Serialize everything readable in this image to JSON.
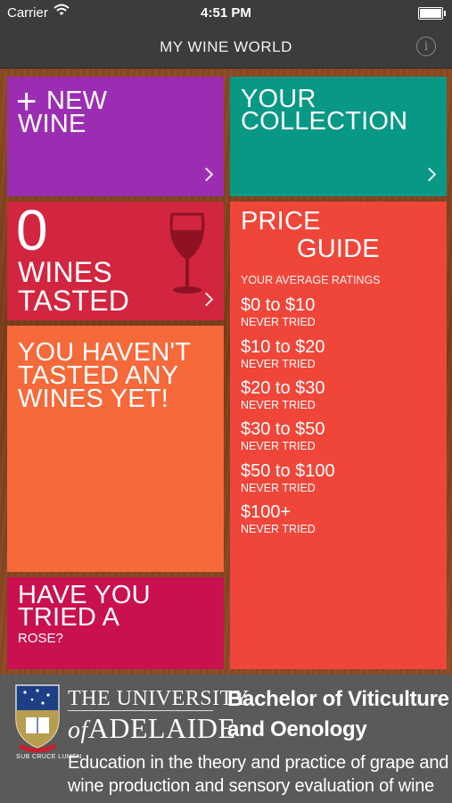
{
  "status_bar": {
    "carrier": "Carrier",
    "time": "4:51 PM"
  },
  "nav": {
    "title": "MY WINE WORLD",
    "info_icon": "i"
  },
  "tiles": {
    "new_wine": {
      "plus": "+",
      "line1": "NEW",
      "line2": "WINE"
    },
    "collection": {
      "line1": "YOUR",
      "line2": "COLLECTION"
    },
    "tasted": {
      "count": "0",
      "line1": "WINES",
      "line2": "TASTED"
    },
    "message": {
      "line1": "YOU HAVEN'T",
      "line2": "TASTED ANY",
      "line3": "WINES YET!"
    },
    "rose": {
      "line1": "HAVE YOU",
      "line2": "TRIED A",
      "line3": "ROSE?"
    }
  },
  "price_guide": {
    "title1": "PRICE",
    "title2": "GUIDE",
    "subtitle": "YOUR AVERAGE RATINGS",
    "ranges": [
      {
        "label": "$0 to $10",
        "status": "NEVER TRIED"
      },
      {
        "label": "$10 to $20",
        "status": "NEVER TRIED"
      },
      {
        "label": "$20 to $30",
        "status": "NEVER TRIED"
      },
      {
        "label": "$30 to $50",
        "status": "NEVER TRIED"
      },
      {
        "label": "$50 to $100",
        "status": "NEVER TRIED"
      },
      {
        "label": "$100+",
        "status": "NEVER TRIED"
      }
    ]
  },
  "footer": {
    "uni_line1": "THE UNIVERSITY",
    "uni_of": "of",
    "uni_line2": "ADELAIDE",
    "motto": "SUB CRUCE LUMEN",
    "degree_line1": "Bachelor of Viticulture",
    "degree_line2": "and Oenology",
    "desc_line1": "Education in the theory and practice of grape and",
    "desc_line2": "wine production and sensory evaluation of wine"
  },
  "colors": {
    "new_wine": "#9b2db3",
    "collection": "#089886",
    "tasted": "#d2253f",
    "message": "#f5693a",
    "rose": "#c9114f",
    "price_guide": "#f0463a"
  }
}
